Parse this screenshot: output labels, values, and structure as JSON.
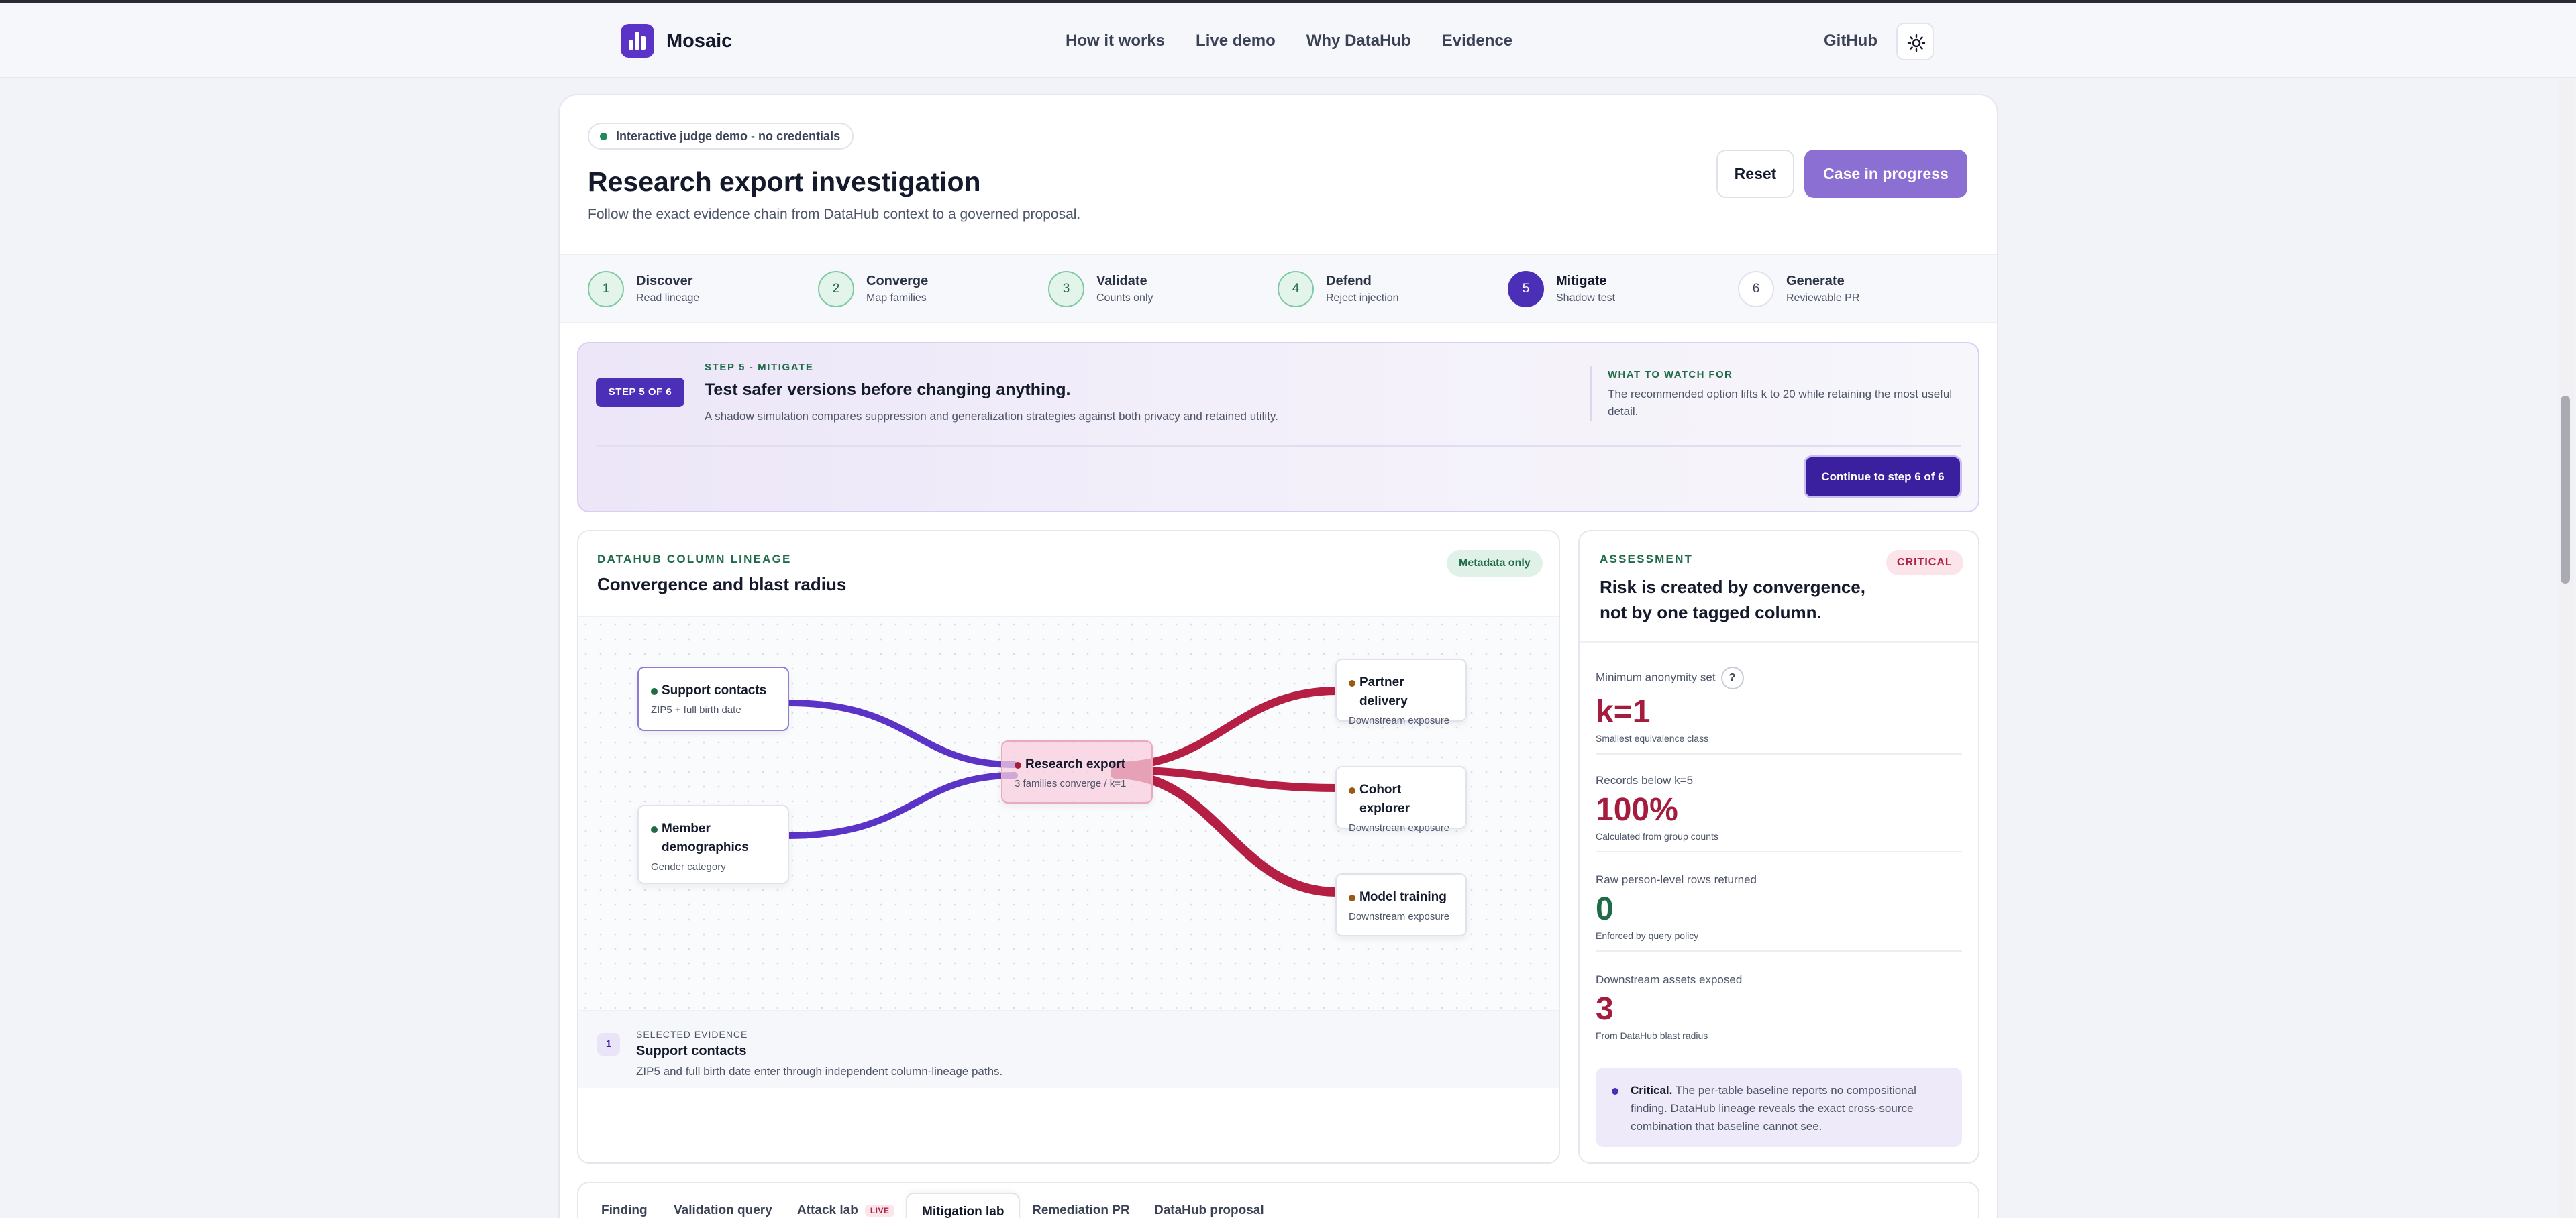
{
  "nav": {
    "brand": "Mosaic",
    "links": [
      "How it works",
      "Live demo",
      "Why DataHub",
      "Evidence"
    ],
    "github": "GitHub"
  },
  "header": {
    "badge": "Interactive judge demo - no credentials",
    "title": "Research export investigation",
    "subtitle": "Follow the exact evidence chain from DataHub context to a governed proposal.",
    "reset_label": "Reset",
    "case_label": "Case in progress"
  },
  "steps": [
    {
      "num": "1",
      "label": "Discover",
      "sub": "Read lineage",
      "state": "done"
    },
    {
      "num": "2",
      "label": "Converge",
      "sub": "Map families",
      "state": "done"
    },
    {
      "num": "3",
      "label": "Validate",
      "sub": "Counts only",
      "state": "done"
    },
    {
      "num": "4",
      "label": "Defend",
      "sub": "Reject injection",
      "state": "done"
    },
    {
      "num": "5",
      "label": "Mitigate",
      "sub": "Shadow test",
      "state": "active"
    },
    {
      "num": "6",
      "label": "Generate",
      "sub": "Reviewable PR",
      "state": "future"
    }
  ],
  "banner": {
    "step_badge": "STEP 5 OF 6",
    "eyebrow": "STEP 5 - MITIGATE",
    "heading": "Test safer versions before changing anything.",
    "description": "A shadow simulation compares suppression and generalization strategies against both privacy and retained utility.",
    "watch_heading": "WHAT TO WATCH FOR",
    "watch_text": "The recommended option lifts k to 20 while retaining the most useful detail.",
    "continue_label": "Continue to step 6 of 6"
  },
  "lineage": {
    "eyebrow": "DATAHUB COLUMN LINEAGE",
    "title": "Convergence and blast radius",
    "badge": "Metadata only",
    "nodes": {
      "support": {
        "title": "Support contacts",
        "sub": "ZIP5 + full birth date"
      },
      "member": {
        "title": "Member demographics",
        "sub": "Gender category"
      },
      "center": {
        "title": "Research export",
        "sub": "3 families converge / k=1"
      },
      "partner": {
        "title": "Partner delivery",
        "sub": "Downstream exposure"
      },
      "cohort": {
        "title": "Cohort explorer",
        "sub": "Downstream exposure"
      },
      "model": {
        "title": "Model training",
        "sub": "Downstream exposure"
      }
    },
    "evidence": {
      "num": "1",
      "label": "SELECTED EVIDENCE",
      "title": "Support contacts",
      "description": "ZIP5 and full birth date enter through independent column-lineage paths."
    },
    "colors": {
      "upstream": "#5b34c7",
      "downstream": "#b51f43"
    }
  },
  "assessment": {
    "eyebrow": "ASSESSMENT",
    "title": "Risk is created by convergence, not by one tagged column.",
    "severity": "CRITICAL",
    "metrics": [
      {
        "label": "Minimum anonymity set",
        "value": "k=1",
        "sub": "Smallest equivalence class",
        "color": "#a51d3e",
        "help": "?"
      },
      {
        "label": "Records below k=5",
        "value": "100%",
        "sub": "Calculated from group counts",
        "color": "#a51d3e"
      },
      {
        "label": "Raw person-level rows returned",
        "value": "0",
        "sub": "Enforced by query policy",
        "color": "#1f6b48"
      },
      {
        "label": "Downstream assets exposed",
        "value": "3",
        "sub": "From DataHub blast radius",
        "color": "#a51d3e"
      }
    ],
    "note_strong": "Critical.",
    "note_text": " The per-table baseline reports no compositional finding. DataHub lineage reveals the exact cross-source combination that baseline cannot see."
  },
  "tabs": {
    "items": [
      "Finding",
      "Validation query",
      "Attack lab",
      "Mitigation lab",
      "Remediation PR",
      "DataHub proposal"
    ],
    "live_badge": "LIVE",
    "active": "Mitigation lab"
  }
}
